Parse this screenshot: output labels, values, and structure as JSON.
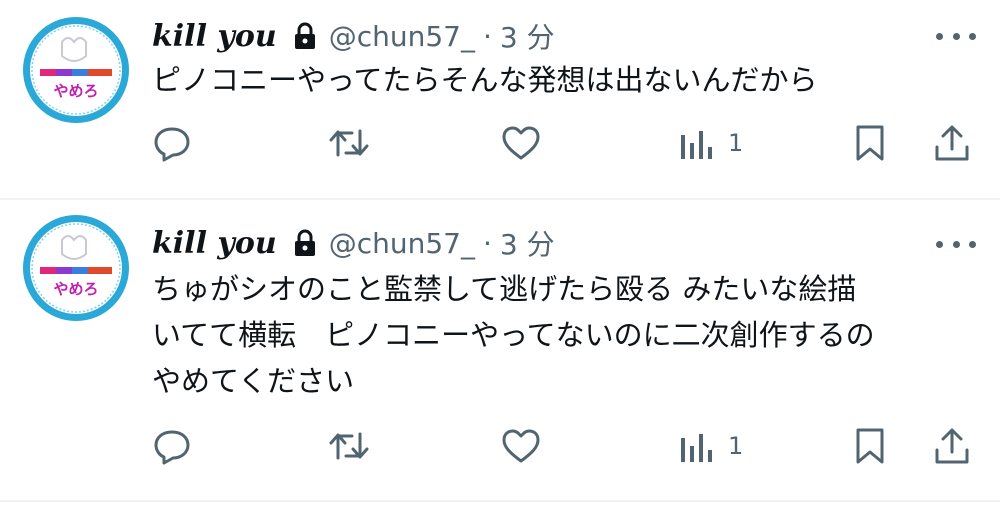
{
  "tweets": [
    {
      "display_name": "kill you",
      "handle": "@chun57_",
      "separator": "·",
      "time": "3 分",
      "text_lines": [
        "ピノコニーやってたらそんな発想は出ないんだから"
      ],
      "views": "1",
      "avatar_text": "やめろ"
    },
    {
      "display_name": "kill you",
      "handle": "@chun57_",
      "separator": "·",
      "time": "3 分",
      "text_lines": [
        "ちゅがシオのこと監禁して逃げたら殴る みたいな絵描",
        "いてて横転　ピノコニーやってないのに二次創作するの",
        "やめてください"
      ],
      "views": "1",
      "avatar_text": "やめろ"
    }
  ],
  "icons": {
    "lock": "lock-icon",
    "more": "more-icon",
    "reply": "reply-icon",
    "retweet": "retweet-icon",
    "like": "heart-icon",
    "views": "analytics-icon",
    "bookmark": "bookmark-icon",
    "share": "share-icon"
  },
  "colors": {
    "text": "#0f1419",
    "secondary": "#536471",
    "divider": "#eff3f4",
    "avatar_ring": "#22a7d6"
  }
}
